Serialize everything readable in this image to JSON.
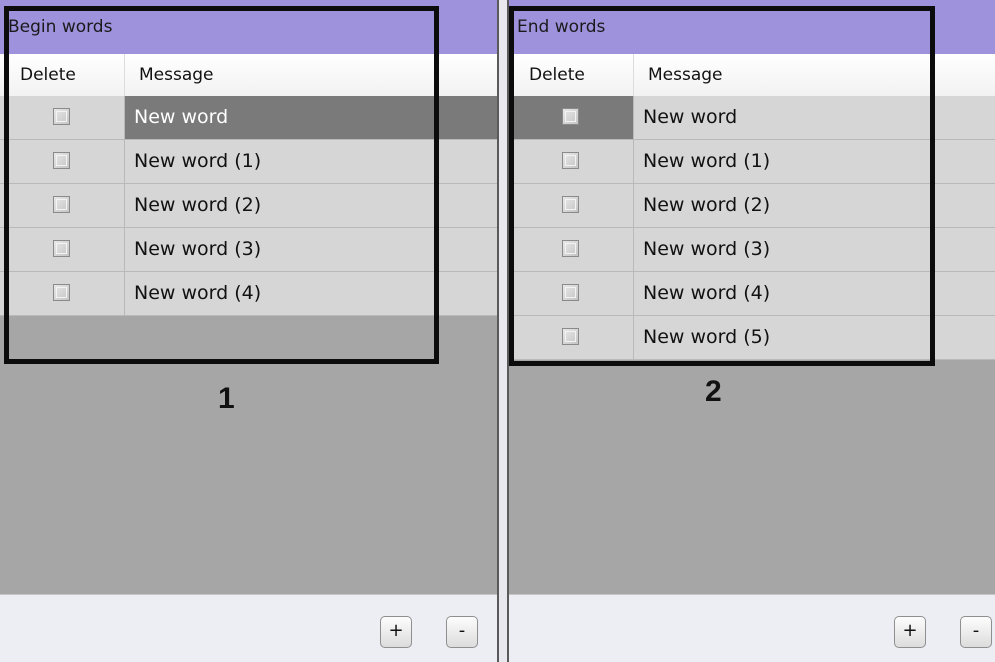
{
  "panels": [
    {
      "title": "Begin words",
      "columns": [
        "Delete",
        "Message"
      ],
      "rows": [
        "New word",
        "New word (1)",
        "New word (2)",
        "New word (3)",
        "New word (4)"
      ],
      "annotation": "1"
    },
    {
      "title": "End words",
      "columns": [
        "Delete",
        "Message"
      ],
      "rows": [
        "New word",
        "New word (1)",
        "New word (2)",
        "New word (3)",
        "New word (4)",
        "New word (5)"
      ],
      "annotation": "2"
    }
  ],
  "buttons": {
    "add_label": "+",
    "remove_label": "-"
  },
  "colors": {
    "header": "#9e92dd",
    "selected_row": "#7a7a7a",
    "row": "#d6d6d6",
    "empty_area": "#a6a6a6"
  }
}
